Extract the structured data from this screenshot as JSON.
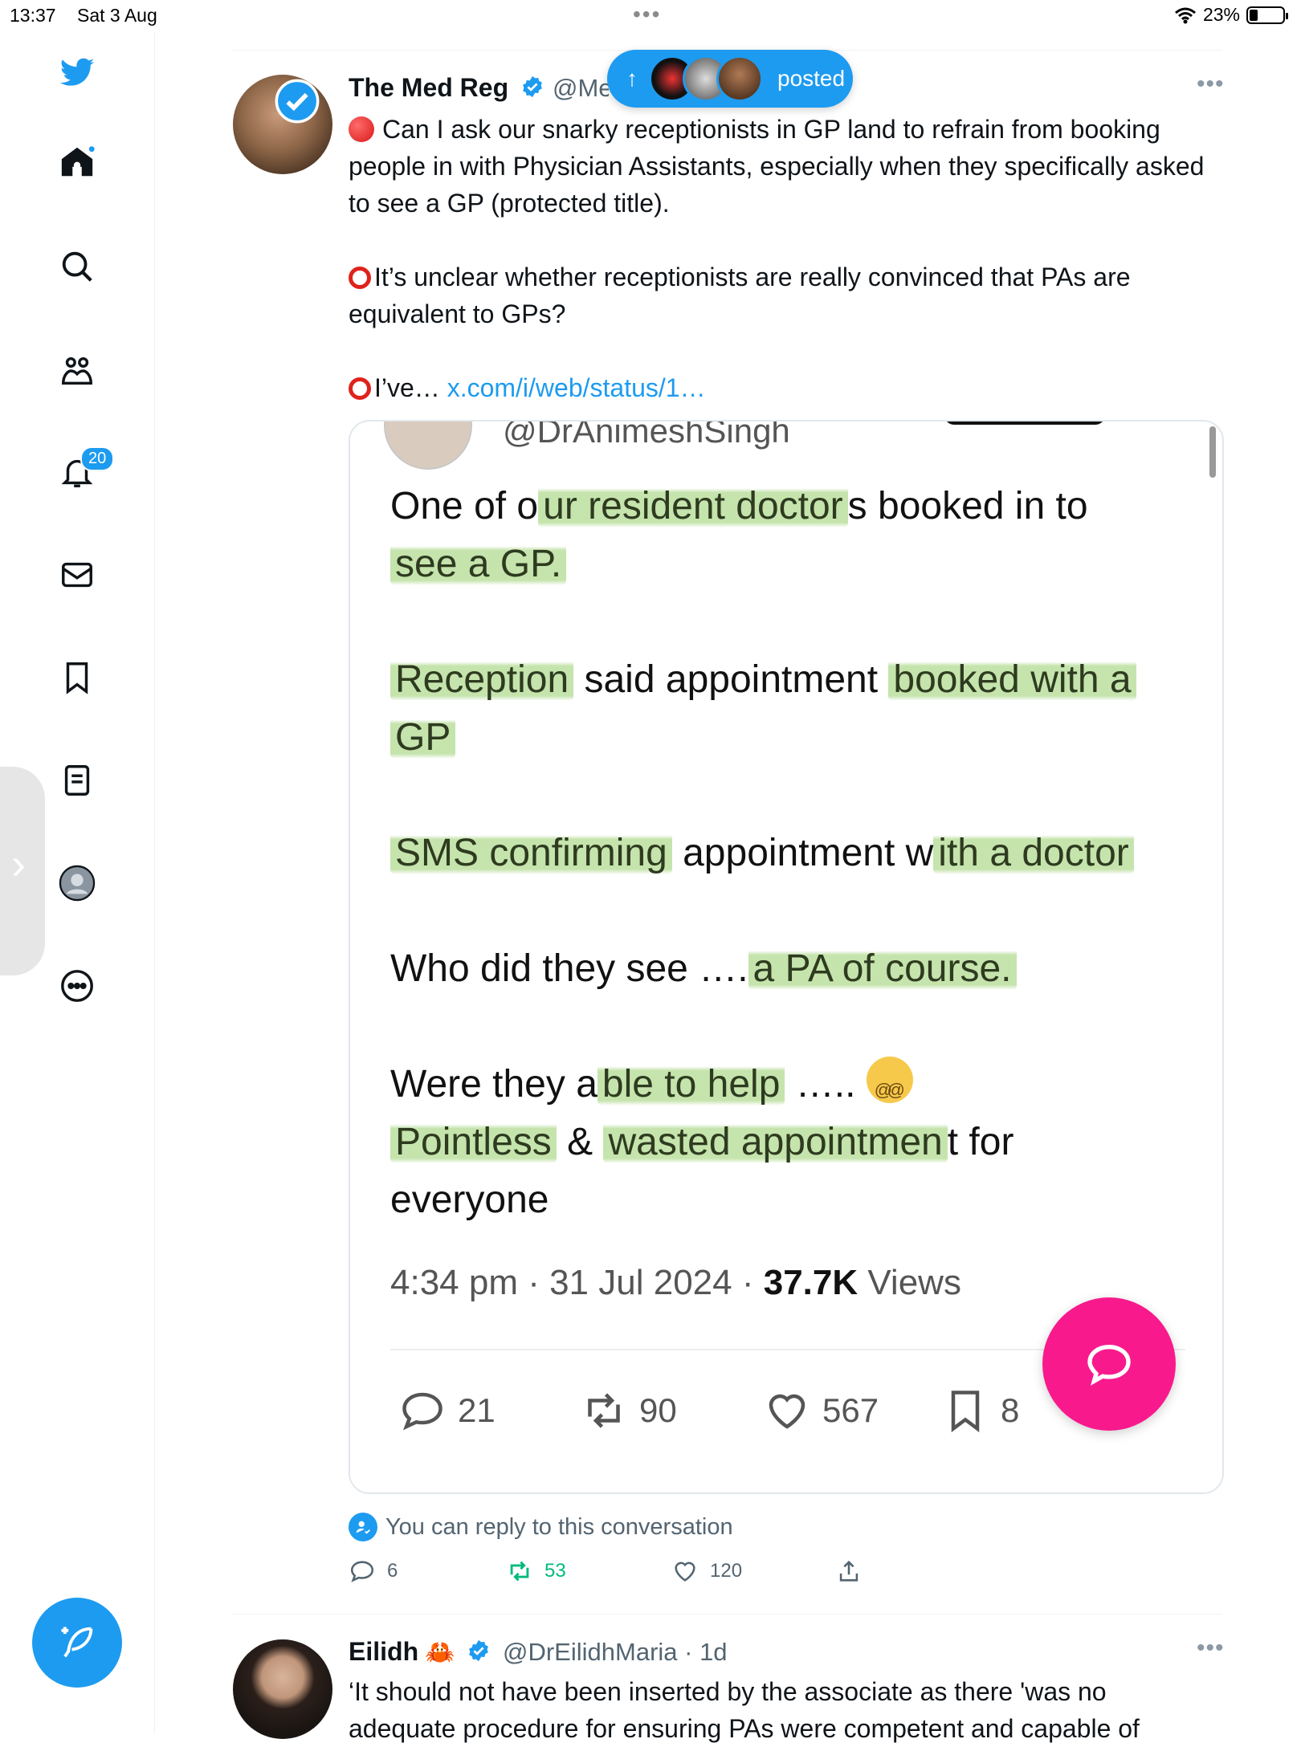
{
  "status_bar": {
    "time": "13:37",
    "date": "Sat 3 Aug",
    "battery": "23%",
    "battery_level": 0.23
  },
  "sidebar": {
    "notifications_badge": "20",
    "items": [
      "twitter-logo",
      "home-icon",
      "search-icon",
      "communities-icon",
      "notifications-icon",
      "messages-icon",
      "bookmarks-icon",
      "lists-icon",
      "profile-icon",
      "more-icon"
    ]
  },
  "posted_pill": {
    "label": "posted"
  },
  "tweet1": {
    "name": "The Med Reg",
    "handle": "@Me",
    "para1": "Can I ask our snarky receptionists in GP land to refrain from booking people in with Physician Assistants, especially when they specifically asked to see a GP (protected title).",
    "para2": "It’s unclear whether receptionists are really convinced that PAs are equivalent to GPs?",
    "para3_prefix": "I’ve…",
    "para3_link": "x.com/i/web/status/1…",
    "media": {
      "top_handle": "@DrAnimeshSingh",
      "line1_a": "One of o",
      "line1_hl": "ur resident doctor",
      "line1_b": "s booked in to",
      "line2_hl": "see a GP.",
      "line3_hl1": "Reception",
      "line3_b": " said appointment ",
      "line3_hl2": "booked with a",
      "line4_hl": "GP",
      "line5_hl1": "SMS confirming",
      "line5_b": " appointment w",
      "line5_hl2": "ith a doctor",
      "line6_a": "Who did they see ….",
      "line6_hl": "a PA of course.",
      "line7_a": "Were they a",
      "line7_hl": "ble to help",
      "line7_b": " …..",
      "line8_hl1": "Pointless",
      "line8_b": " & ",
      "line8_hl2": "wasted appointmen",
      "line8_c": "t for",
      "line9": "everyone",
      "meta_time": "4:34 pm · 31 Jul 2024 · ",
      "meta_views_num": "37.7K",
      "meta_views_label": " Views",
      "stats": {
        "replies": "21",
        "retweets": "90",
        "likes": "567",
        "bookmarks": "8"
      }
    },
    "reply_note": "You can reply to this conversation",
    "actions": {
      "replies": "6",
      "retweets": "53",
      "likes": "120"
    }
  },
  "tweet2": {
    "name": "Eilidh",
    "handle_time": "@DrEilidhMaria · 1d",
    "text": "‘It should not have been inserted by the associate as there 'was no adequate procedure for ensuring PAs were competent and capable of"
  },
  "colors": {
    "accent": "#1d9bf0",
    "fab": "#f81a8c",
    "retweet_green": "#00ba7c",
    "highlight": "#96cd69"
  }
}
